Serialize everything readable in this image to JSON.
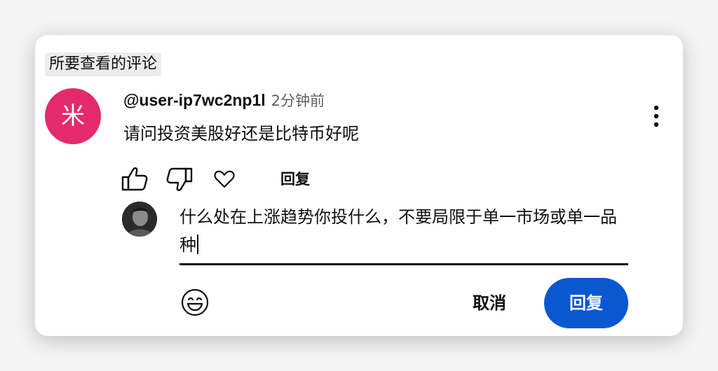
{
  "section_label": "所要查看的评论",
  "comment": {
    "avatar_letter": "米",
    "avatar_color": "#e32b6b",
    "author": "@user-ip7wc2np1l",
    "time": "2分钟前",
    "text": "请问投资美股好还是比特币好呢"
  },
  "actions": {
    "like_icon": "thumbs-up-icon",
    "dislike_icon": "thumbs-down-icon",
    "heart_icon": "heart-icon",
    "reply_label": "回复"
  },
  "reply_box": {
    "text": "什么处在上涨趋势你投什么，不要局限于单一市场或单一品种",
    "cancel_label": "取消",
    "submit_label": "回复",
    "submit_color": "#0b57d0"
  },
  "menu_icon": "more-vert-icon",
  "emoji_icon": "smiley-icon"
}
